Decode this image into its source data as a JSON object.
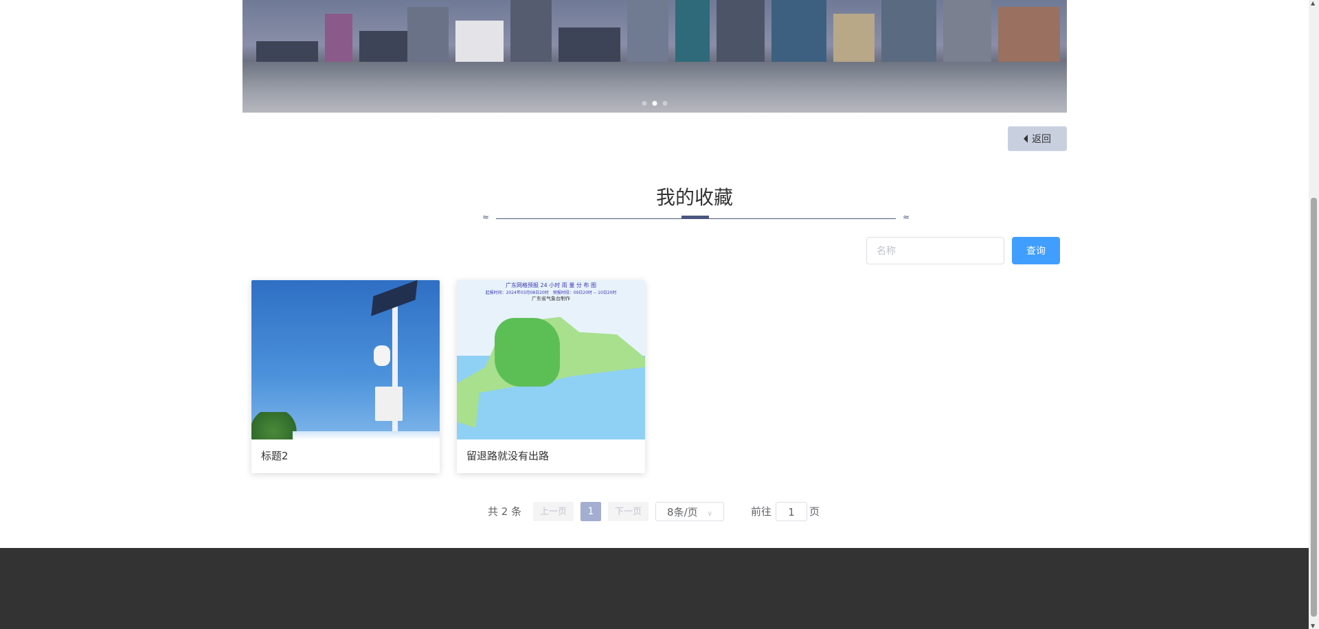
{
  "banner": {
    "slides": 3,
    "active_slide": 2
  },
  "back_button": {
    "label": "返回"
  },
  "section": {
    "title": "我的收藏"
  },
  "search": {
    "placeholder": "名称",
    "value": "",
    "button_label": "查询"
  },
  "cards": [
    {
      "title": "标题2",
      "image": "weather-station-photo"
    },
    {
      "title": "留退路就没有出路",
      "image": "guangdong-rainfall-map",
      "image_text": {
        "heading": "广东网格预报 24 小时 雨 量 分 布 图",
        "subheading": "起报时间：2024年03月08日20时　预报时段：09日20时 -- 10日20时",
        "maker": "广东省气象台制作"
      }
    }
  ],
  "pagination": {
    "total": "共 2 条",
    "prev": "上一页",
    "current": "1",
    "next": "下一页",
    "page_size": "8条/页",
    "goto_label": "前往",
    "goto_value": "1",
    "page_suffix": "页"
  },
  "colors": {
    "accent": "#409eff",
    "title_underline": "#4a5680",
    "footer": "#333333",
    "current_page": "#a3aed0"
  }
}
